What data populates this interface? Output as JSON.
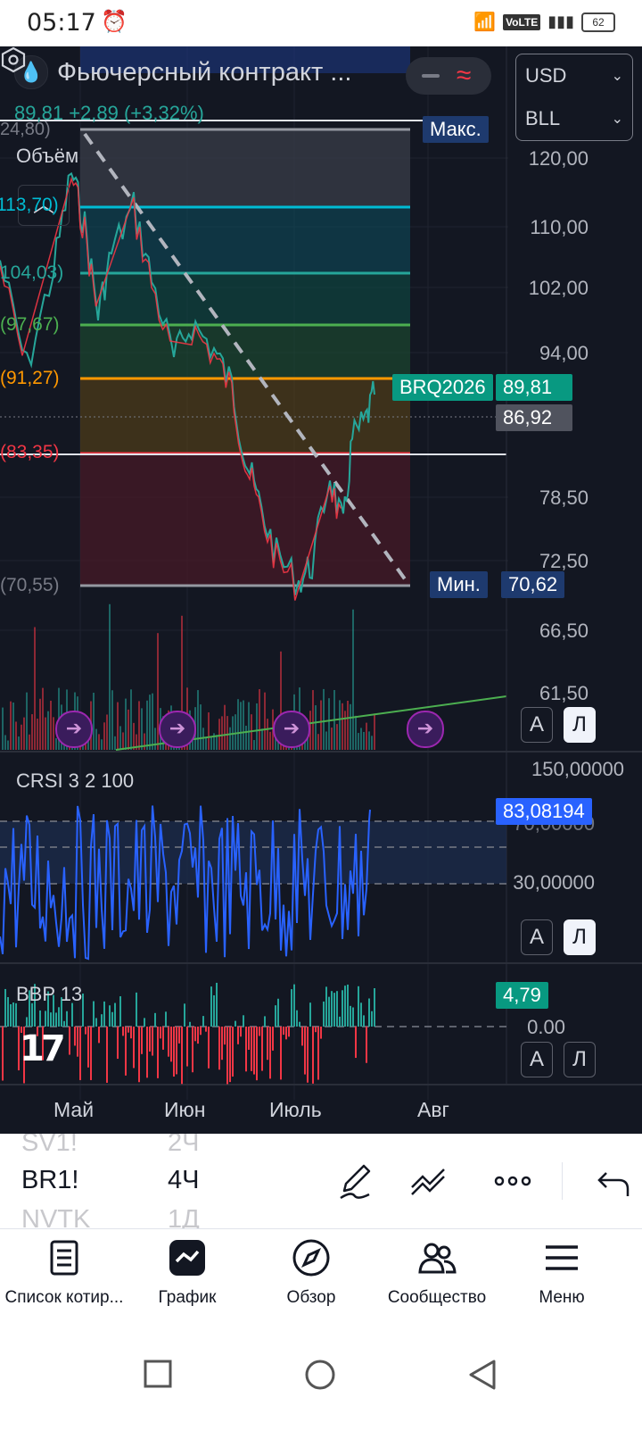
{
  "status": {
    "time": "05:17",
    "network": "VoLTE",
    "battery": "62"
  },
  "header": {
    "symbol_title": "Фьючерсный контракт ...",
    "currency": "USD",
    "unit": "BLL"
  },
  "price_line": {
    "last": "89,81",
    "change": "+2,89 (+3,32%)",
    "prev_label": "24,80)"
  },
  "volume_label": "Объём",
  "price_axis": [
    "120,00",
    "110,00",
    "102,00",
    "94,00",
    "78,50",
    "72,50",
    "66,50",
    "61,50"
  ],
  "tags": {
    "max_label": "Макс.",
    "min_label": "Мин.",
    "min_value": "70,62",
    "symbol_tag": "BRQ2026",
    "last_price": "89,81",
    "prev_close": "86,92"
  },
  "fib_levels": [
    {
      "label": "113,70)",
      "color": "#00bcd4"
    },
    {
      "label": "104,03)",
      "color": "#26a69a"
    },
    {
      "label": "(97,67)",
      "color": "#4caf50"
    },
    {
      "label": "(91,27)",
      "color": "#ff9800"
    },
    {
      "label": "(83,35)",
      "color": "#f23645"
    },
    {
      "label": "(70,55)",
      "color": "#787b86"
    }
  ],
  "crsi": {
    "label": "CRSI 3 2 100",
    "top": "150,00000",
    "upper": "70,00000",
    "lower": "30,00000",
    "value": "83,08194"
  },
  "bbp": {
    "label": "BBP 13",
    "value": "4,79",
    "zero": "0.00"
  },
  "scale_buttons": {
    "auto": "A",
    "log": "Л"
  },
  "time_axis": [
    "Май",
    "Июн",
    "Июль",
    "Авг"
  ],
  "symbols": [
    {
      "name": "SV1!",
      "interval": "2Ч"
    },
    {
      "name": "BR1!",
      "interval": "4Ч"
    },
    {
      "name": "NVTK",
      "interval": "1Д"
    }
  ],
  "nav": [
    {
      "label": "Список котир...",
      "icon": "watchlist-icon"
    },
    {
      "label": "График",
      "icon": "chart-icon"
    },
    {
      "label": "Обзор",
      "icon": "compass-icon"
    },
    {
      "label": "Сообщество",
      "icon": "community-icon"
    },
    {
      "label": "Меню",
      "icon": "menu-icon"
    }
  ],
  "colors": {
    "bg": "#131722",
    "up": "#26a69a",
    "down": "#f23645",
    "crsi": "#2962ff",
    "accent": "#2962ff"
  }
}
